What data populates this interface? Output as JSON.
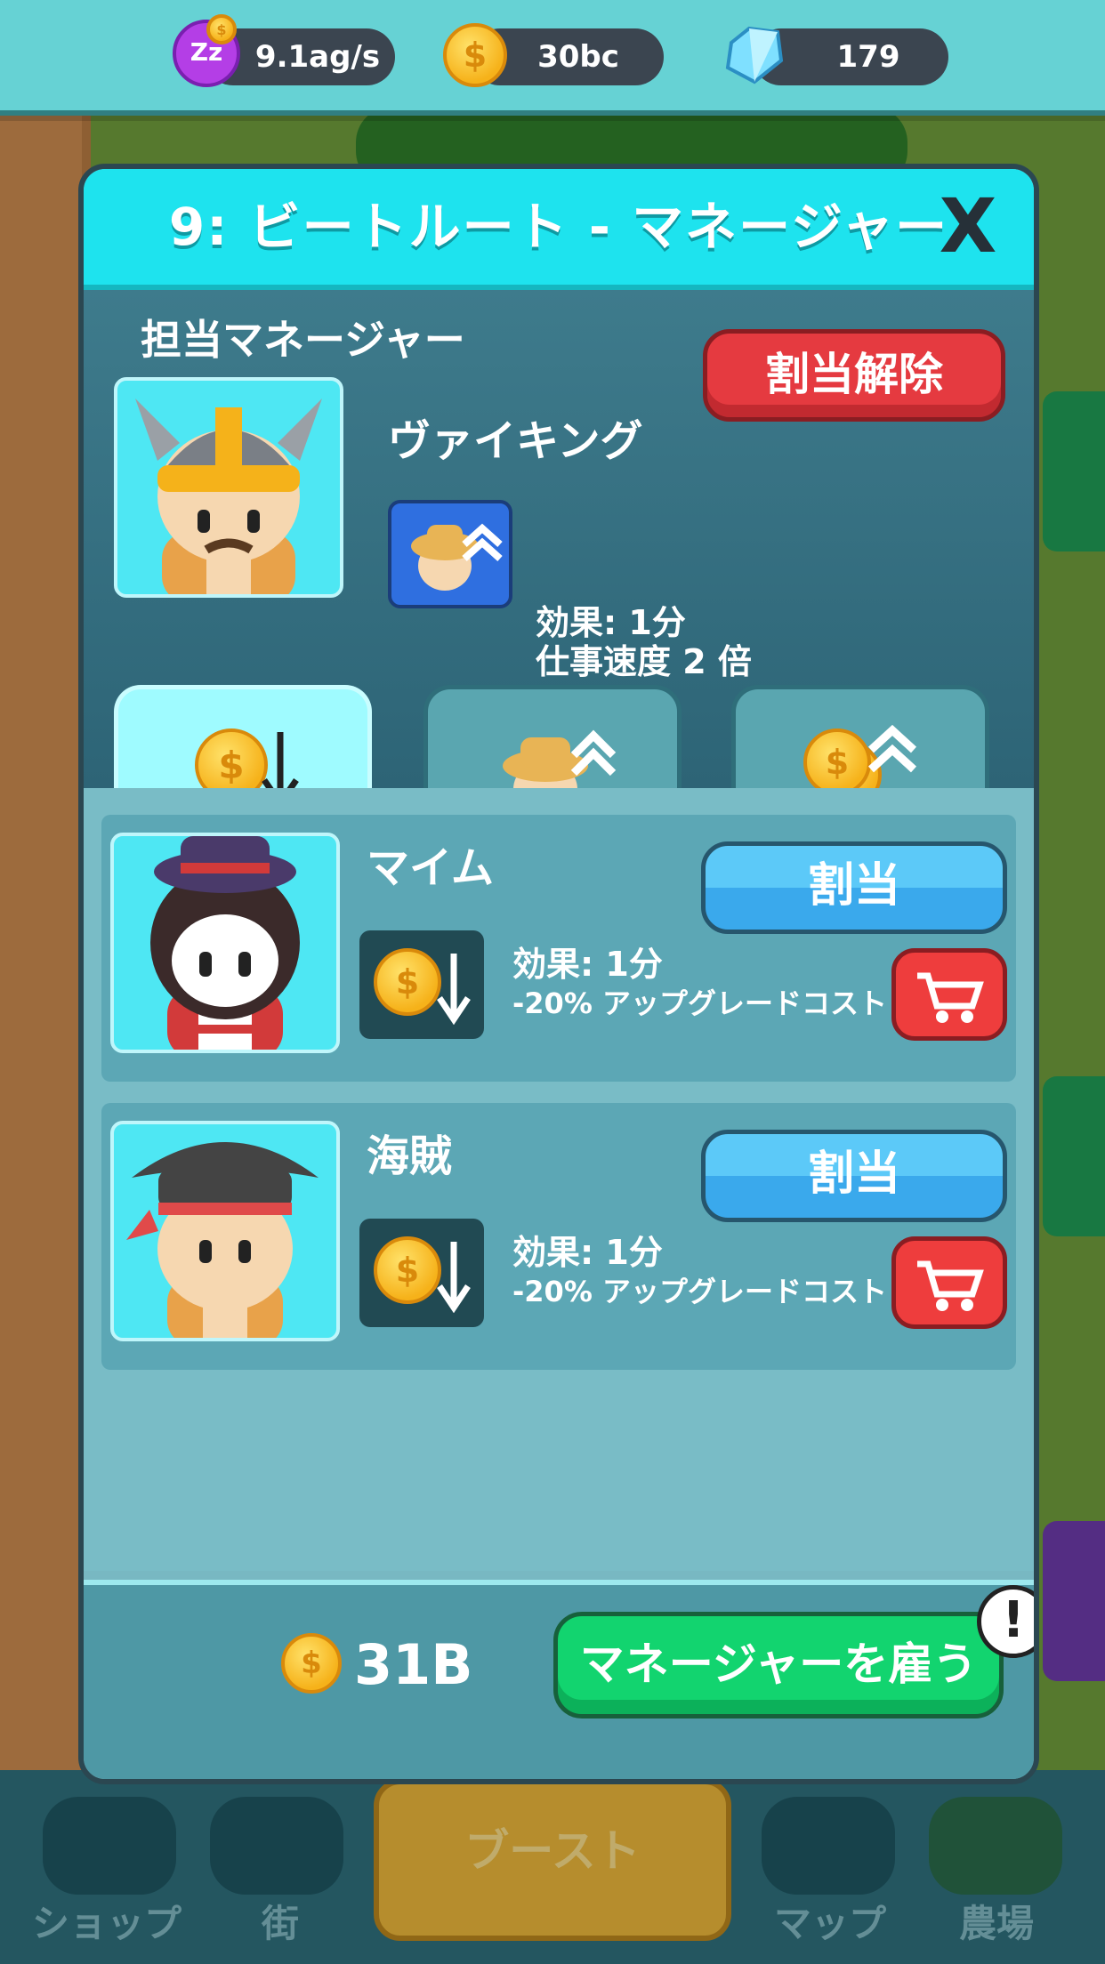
{
  "topbar": {
    "idle_rate": "9.1ag/s",
    "coins": "30bc",
    "gems": "179"
  },
  "modal": {
    "title": "9: ビートルート - マネージャー",
    "close_label": "X",
    "section_label": "担当マネージャー",
    "unassign_label": "割当解除",
    "current_manager": {
      "name": "ヴァイキング",
      "effect_line1": "効果: 1分",
      "effect_line2": "仕事速度 2 倍"
    },
    "tabs": [
      "cost-down",
      "worker-speed-up",
      "coin-up"
    ],
    "managers": [
      {
        "name": "マイム",
        "assign_label": "割当",
        "effect_line1": "効果: 1分",
        "effect_line2": "-20% アップグレードコスト"
      },
      {
        "name": "海賊",
        "assign_label": "割当",
        "effect_line1": "効果: 1分",
        "effect_line2": "-20% アップグレードコスト"
      }
    ],
    "footer": {
      "price": "31B",
      "hire_label": "マネージャーを雇う",
      "alert": "!"
    }
  },
  "bottom_nav": {
    "shop": "ショップ",
    "town": "街",
    "boost": "ブースト",
    "map": "マップ",
    "farm": "農場"
  },
  "colors": {
    "header": "#1ee3ee",
    "assign": "#3aa9ec",
    "unassign": "#e53a40",
    "hire": "#12d46f"
  }
}
